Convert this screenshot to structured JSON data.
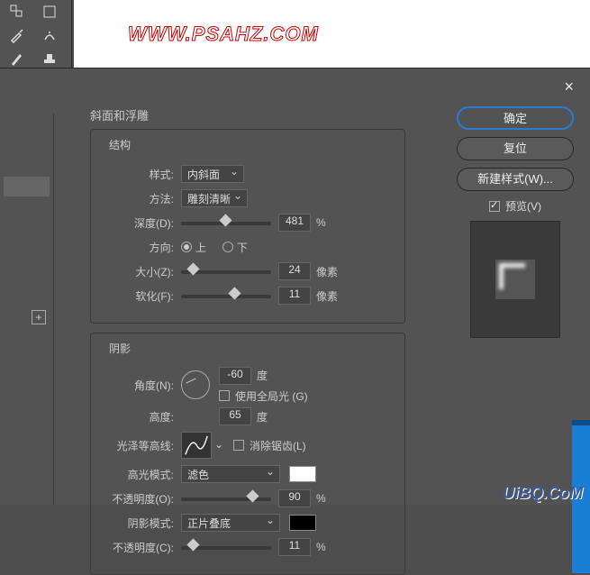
{
  "watermark": "WWW.PSAHZ.COM",
  "dialog_title": "斜面和浮雕",
  "close": "×",
  "structure": {
    "legend": "结构",
    "style_label": "样式:",
    "style_value": "内斜面",
    "technique_label": "方法:",
    "technique_value": "雕刻清晰",
    "depth_label": "深度(D):",
    "depth_value": "481",
    "percent": "%",
    "direction_label": "方向:",
    "dir_up": "上",
    "dir_down": "下",
    "size_label": "大小(Z):",
    "size_value": "24",
    "px": "像素",
    "soften_label": "软化(F):",
    "soften_value": "11"
  },
  "shading": {
    "legend": "阴影",
    "angle_label": "角度(N):",
    "angle_value": "-60",
    "deg": "度",
    "global_light": "使用全局光 (G)",
    "altitude_label": "高度:",
    "altitude_value": "65",
    "gloss_label": "光泽等高线:",
    "antialias": "消除锯齿(L)",
    "highlight_mode_label": "高光模式:",
    "highlight_mode_value": "滤色",
    "opacity_o_label": "不透明度(O):",
    "opacity_o_value": "90",
    "shadow_mode_label": "阴影模式:",
    "shadow_mode_value": "正片叠底",
    "opacity_c_label": "不透明度(C):",
    "opacity_c_value": "11"
  },
  "buttons": {
    "ok": "确定",
    "reset": "复位",
    "new_style": "新建样式(W)...",
    "preview": "预览(V)"
  },
  "uibq": "UiBQ.CoM"
}
